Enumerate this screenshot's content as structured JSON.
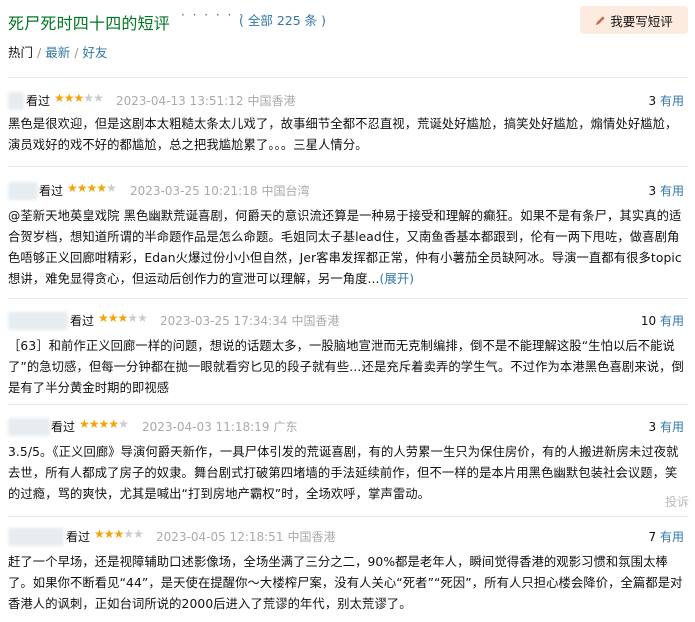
{
  "header": {
    "title": "死尸死时四十四的短评",
    "dots": "· · · · · ·",
    "count": "( 全部 225 条 )",
    "write_label": "我要写短评"
  },
  "tabs": {
    "hot": "热门",
    "sep1": "/",
    "latest": "最新",
    "sep2": "/",
    "friends": "好友"
  },
  "comments": [
    {
      "seen": "看过",
      "rating": 3,
      "time": "2023-04-13 13:51:12",
      "location": "中国香港",
      "votes": "3",
      "useful_label": "有用",
      "text": "黑色是很欢迎，但是这剧本太粗糙太条太儿戏了，故事细节全都不忍直视，荒诞处好尴尬，搞笑处好尴尬，煽情处好尴尬，演员戏好的戏不好的都尴尬，总之把我尴尬累了。。。三星人情分。"
    },
    {
      "seen": "看过",
      "rating": 4,
      "time": "2023-03-25 10:21:18",
      "location": "中国台湾",
      "votes": "3",
      "useful_label": "有用",
      "text": "@荃新天地英皇戏院 黑色幽默荒诞喜剧，何爵天的意识流还算是一种易于接受和理解的癫狂。如果不是有条尸，其实真的适合贺岁档，想知道所谓的半命题作品是怎么命题。毛姐同太子基lead住，又南鱼香基本都跟到，伦有一两下甩咗，做喜剧角色唔够正义回廊咁精彩，Edan火爆过份小小但自然，Jer客串发挥都正常，仲有小薯茄全员缺阿冰。导演一直都有很多topic想讲，难免显得贪心，但运动后创作力的宣泄可以理解，另一角度...",
      "expand": "(展开)"
    },
    {
      "seen": "看过",
      "rating": 3,
      "time": "2023-03-25 17:34:34",
      "location": "中国香港",
      "votes": "10",
      "useful_label": "有用",
      "text": "［63］和前作正义回廊一样的问题，想说的话题太多，一股脑地宣泄而无克制编排，倒不是不能理解这股“生怕以后不能说了”的急切感，但每一分钟都在抛一眼就看穷匕见的段子就有些…还是充斥着卖弄的学生气。不过作为本港黑色喜剧来说，倒是有了半分黄金时期的即视感"
    },
    {
      "seen": "看过",
      "rating": 4,
      "time": "2023-04-03 11:18:19",
      "location": "广东",
      "votes": "3",
      "useful_label": "有用",
      "text": "3.5/5。《正义回廊》导演何爵天新作，一具尸体引发的荒诞喜剧，有的人劳累一生只为保住房价，有的人搬进新房未过夜就去世，所有人都成了房子的奴隶。舞台剧式打破第四堵墙的手法延续前作，但不一样的是本片用黑色幽默包装社会议题，笑的过瘾，骂的爽快，尤其是喊出“打到房地产霸权”时，全场欢呼，掌声雷动。",
      "report": "投诉"
    },
    {
      "seen": "看过",
      "rating": 3,
      "time": "2023-04-05 12:18:51",
      "location": "中国香港",
      "votes": "7",
      "useful_label": "有用",
      "text": "赶了一个早场，还是视障辅助口述影像场，全场坐满了三分之二，90%都是老年人，瞬间觉得香港的观影习惯和氛围太棒了。如果你不断看见“44”，是天使在提醒你～大楼榨尸案，没有人关心“死者”“死因”，所有人只担心楼会降价，全篇都是对香港人的讽刺，正如台词所说的2000后进入了荒谬的年代，别太荒谬了。"
    }
  ]
}
